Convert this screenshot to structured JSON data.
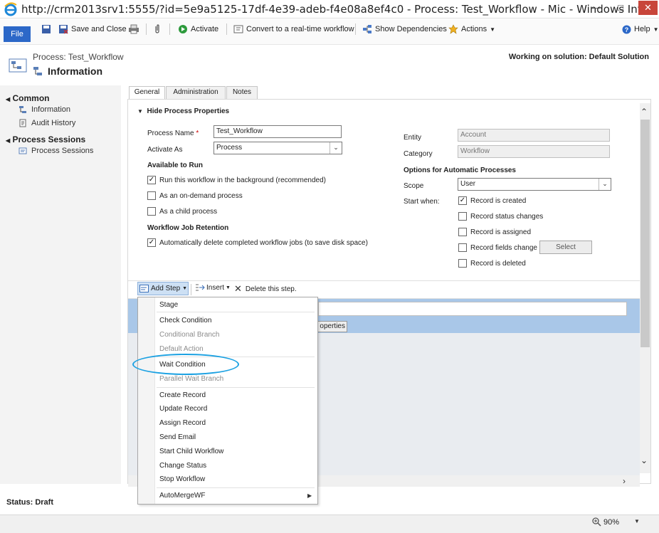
{
  "window": {
    "title": "http://crm2013srv1:5555/?id=5e9a5125-17df-4e39-adeb-f4e08a8ef4c0 - Process: Test_Workflow - Mic - Windows Inter...",
    "close_label": "✕"
  },
  "ribbon": {
    "file": "File",
    "save_close": "Save and Close",
    "activate": "Activate",
    "convert": "Convert to a real-time workflow",
    "show_deps": "Show Dependencies",
    "actions": "Actions",
    "help": "Help"
  },
  "header": {
    "super_title": "Process: Test_Workflow",
    "title": "Information",
    "solution": "Working on solution: Default Solution"
  },
  "nav": {
    "common": "Common",
    "information": "Information",
    "audit_history": "Audit History",
    "process_sessions_header": "Process Sessions",
    "process_sessions": "Process Sessions"
  },
  "tabs": [
    "General",
    "Administration",
    "Notes"
  ],
  "form": {
    "section_toggle": "Hide Process Properties",
    "process_name_label": "Process Name",
    "process_name": "Test_Workflow",
    "activate_as_label": "Activate As",
    "activate_as": "Process",
    "available_to_run": "Available to Run",
    "run_background": "Run this workflow in the background (recommended)",
    "on_demand": "As an on-demand process",
    "child_process": "As a child process",
    "job_retention": "Workflow Job Retention",
    "auto_delete": "Automatically delete completed workflow jobs (to save disk space)",
    "entity_label": "Entity",
    "entity": "Account",
    "category_label": "Category",
    "category": "Workflow",
    "options_header": "Options for Automatic Processes",
    "scope_label": "Scope",
    "scope": "User",
    "start_when_label": "Start when:",
    "record_created": "Record is created",
    "record_status": "Record status changes",
    "record_assigned": "Record is assigned",
    "record_fields": "Record fields change",
    "select_btn": "Select",
    "record_deleted": "Record is deleted",
    "checks": {
      "run_background": true,
      "on_demand": false,
      "child_process": false,
      "auto_delete": true,
      "record_created": true,
      "record_status": false,
      "record_assigned": false,
      "record_fields": false,
      "record_deleted": false
    }
  },
  "designer": {
    "add_step": "Add Step",
    "insert": "Insert",
    "delete_step": "Delete this step.",
    "properties_btn": "operties"
  },
  "menu": {
    "stage": "Stage",
    "check_condition": "Check Condition",
    "conditional_branch": "Conditional Branch",
    "default_action": "Default Action",
    "wait_condition": "Wait Condition",
    "parallel_wait": "Parallel Wait Branch",
    "create_record": "Create Record",
    "update_record": "Update Record",
    "assign_record": "Assign Record",
    "send_email": "Send Email",
    "start_child": "Start Child Workflow",
    "change_status": "Change Status",
    "stop_workflow": "Stop Workflow",
    "auto_merge": "AutoMergeWF"
  },
  "status": {
    "text": "Status: Draft",
    "zoom": "90%"
  },
  "colors": {
    "accent": "#2c68c8",
    "highlight_ring": "#1ba1e2"
  }
}
